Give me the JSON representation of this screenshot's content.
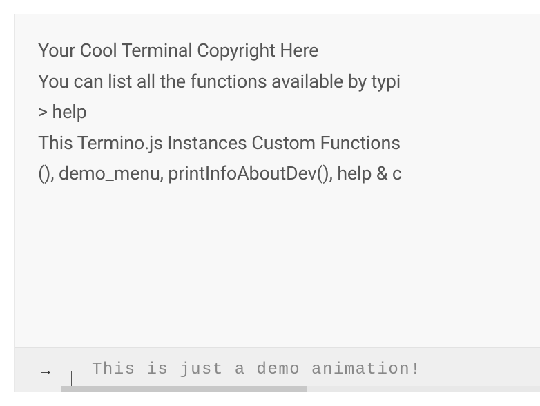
{
  "terminal": {
    "output_lines": [
      "Your Cool Terminal Copyright Here",
      "You can list all the functions available by typi",
      "> help",
      "This Termino.js Instances Custom Functions ",
      "(), demo_menu, printInfoAboutDev(), help & c"
    ],
    "prompt_symbol": "→",
    "input_value": "This is just a demo animation!"
  }
}
